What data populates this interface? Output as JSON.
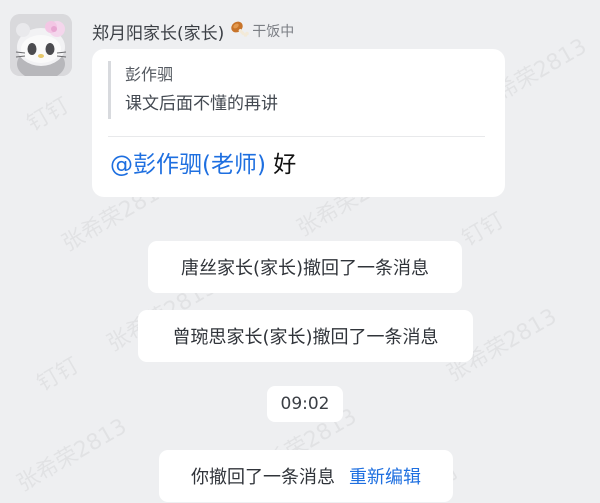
{
  "sender": {
    "name": "郑月阳家长(家长)",
    "status_text": "干饭中",
    "status_icon": "drumstick-icon"
  },
  "message": {
    "quote_author": "彭作驷",
    "quote_text": "课文后面不懂的再讲",
    "mention": "@彭作驷(老师)",
    "reply_text": "好"
  },
  "system_messages": [
    "唐丝家长(家长)撤回了一条消息",
    "曾琬思家长(家长)撤回了一条消息"
  ],
  "timestamp": "09:02",
  "self_recall": {
    "text": "你撤回了一条消息",
    "action_label": "重新编辑"
  },
  "watermark": {
    "name": "张希荣2813",
    "app": "钉钉"
  },
  "colors": {
    "background": "#eeeff1",
    "bubble": "#ffffff",
    "accent_blue": "#1e6fe0"
  }
}
